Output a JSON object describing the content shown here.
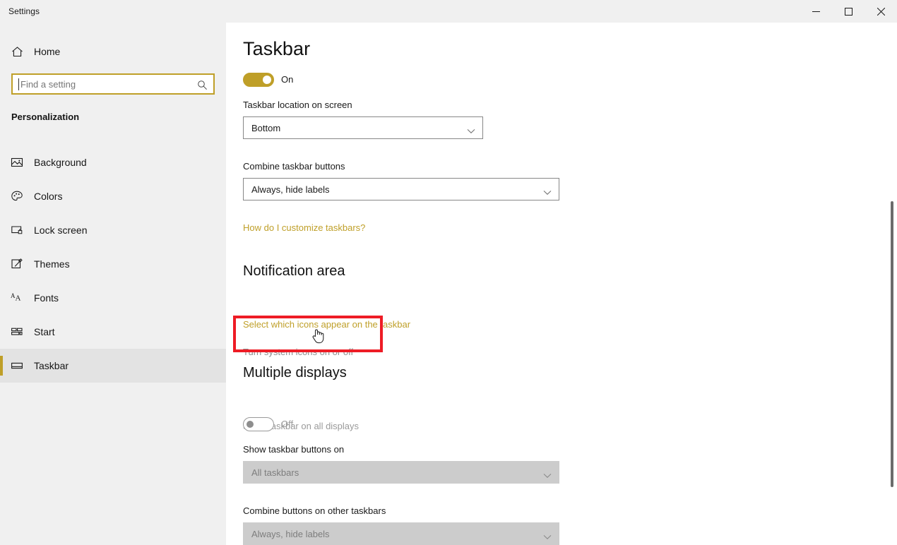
{
  "window": {
    "title": "Settings",
    "controls": [
      {
        "name": "minimize",
        "label": "Minimize"
      },
      {
        "name": "maximize",
        "label": "Maximize"
      },
      {
        "name": "close",
        "label": "Close"
      }
    ]
  },
  "sidebar": {
    "home_label": "Home",
    "home_icon": "home-icon",
    "search": {
      "placeholder": "Find a setting",
      "value": "",
      "icon": "search-icon"
    },
    "category": "Personalization",
    "items": [
      {
        "label": "Background",
        "icon": "image-icon",
        "selected": false
      },
      {
        "label": "Colors",
        "icon": "palette-icon",
        "selected": false
      },
      {
        "label": "Lock screen",
        "icon": "lock-screen-icon",
        "selected": false
      },
      {
        "label": "Themes",
        "icon": "brush-icon",
        "selected": false
      },
      {
        "label": "Fonts",
        "icon": "fonts-aa-icon",
        "selected": false
      },
      {
        "label": "Start",
        "icon": "start-tiles-icon",
        "selected": false
      },
      {
        "label": "Taskbar",
        "icon": "taskbar-icon",
        "selected": true
      }
    ]
  },
  "main": {
    "page_title": "Taskbar",
    "taskbar_toggle": {
      "state_label": "On",
      "on": true
    },
    "location_label": "Taskbar location on screen",
    "location_value": "Bottom",
    "combine_label": "Combine taskbar buttons",
    "combine_value": "Always, hide labels",
    "help_link": "How do I customize taskbars?",
    "notification": {
      "heading": "Notification area",
      "select_icons_link": "Select which icons appear on the taskbar",
      "system_icons_link": "Turn system icons on or off"
    },
    "multiple_displays": {
      "heading": "Multiple displays",
      "show_all_label": "Show taskbar on all displays",
      "show_all_state": "Off",
      "buttons_on_label": "Show taskbar buttons on",
      "buttons_on_value": "All taskbars",
      "combine_other_label": "Combine buttons on other taskbars",
      "combine_other_value": "Always, hide labels"
    }
  },
  "annotation": {
    "highlight_target": "Turn system icons on or off",
    "highlight_color": "#ee1c25",
    "cursor": "hand-pointer-cursor"
  },
  "theme": {
    "accent": "#bf9f28",
    "sidebar_bg": "#f0f0f0",
    "content_bg": "#ffffff",
    "disabled_fill": "#cccccc"
  }
}
